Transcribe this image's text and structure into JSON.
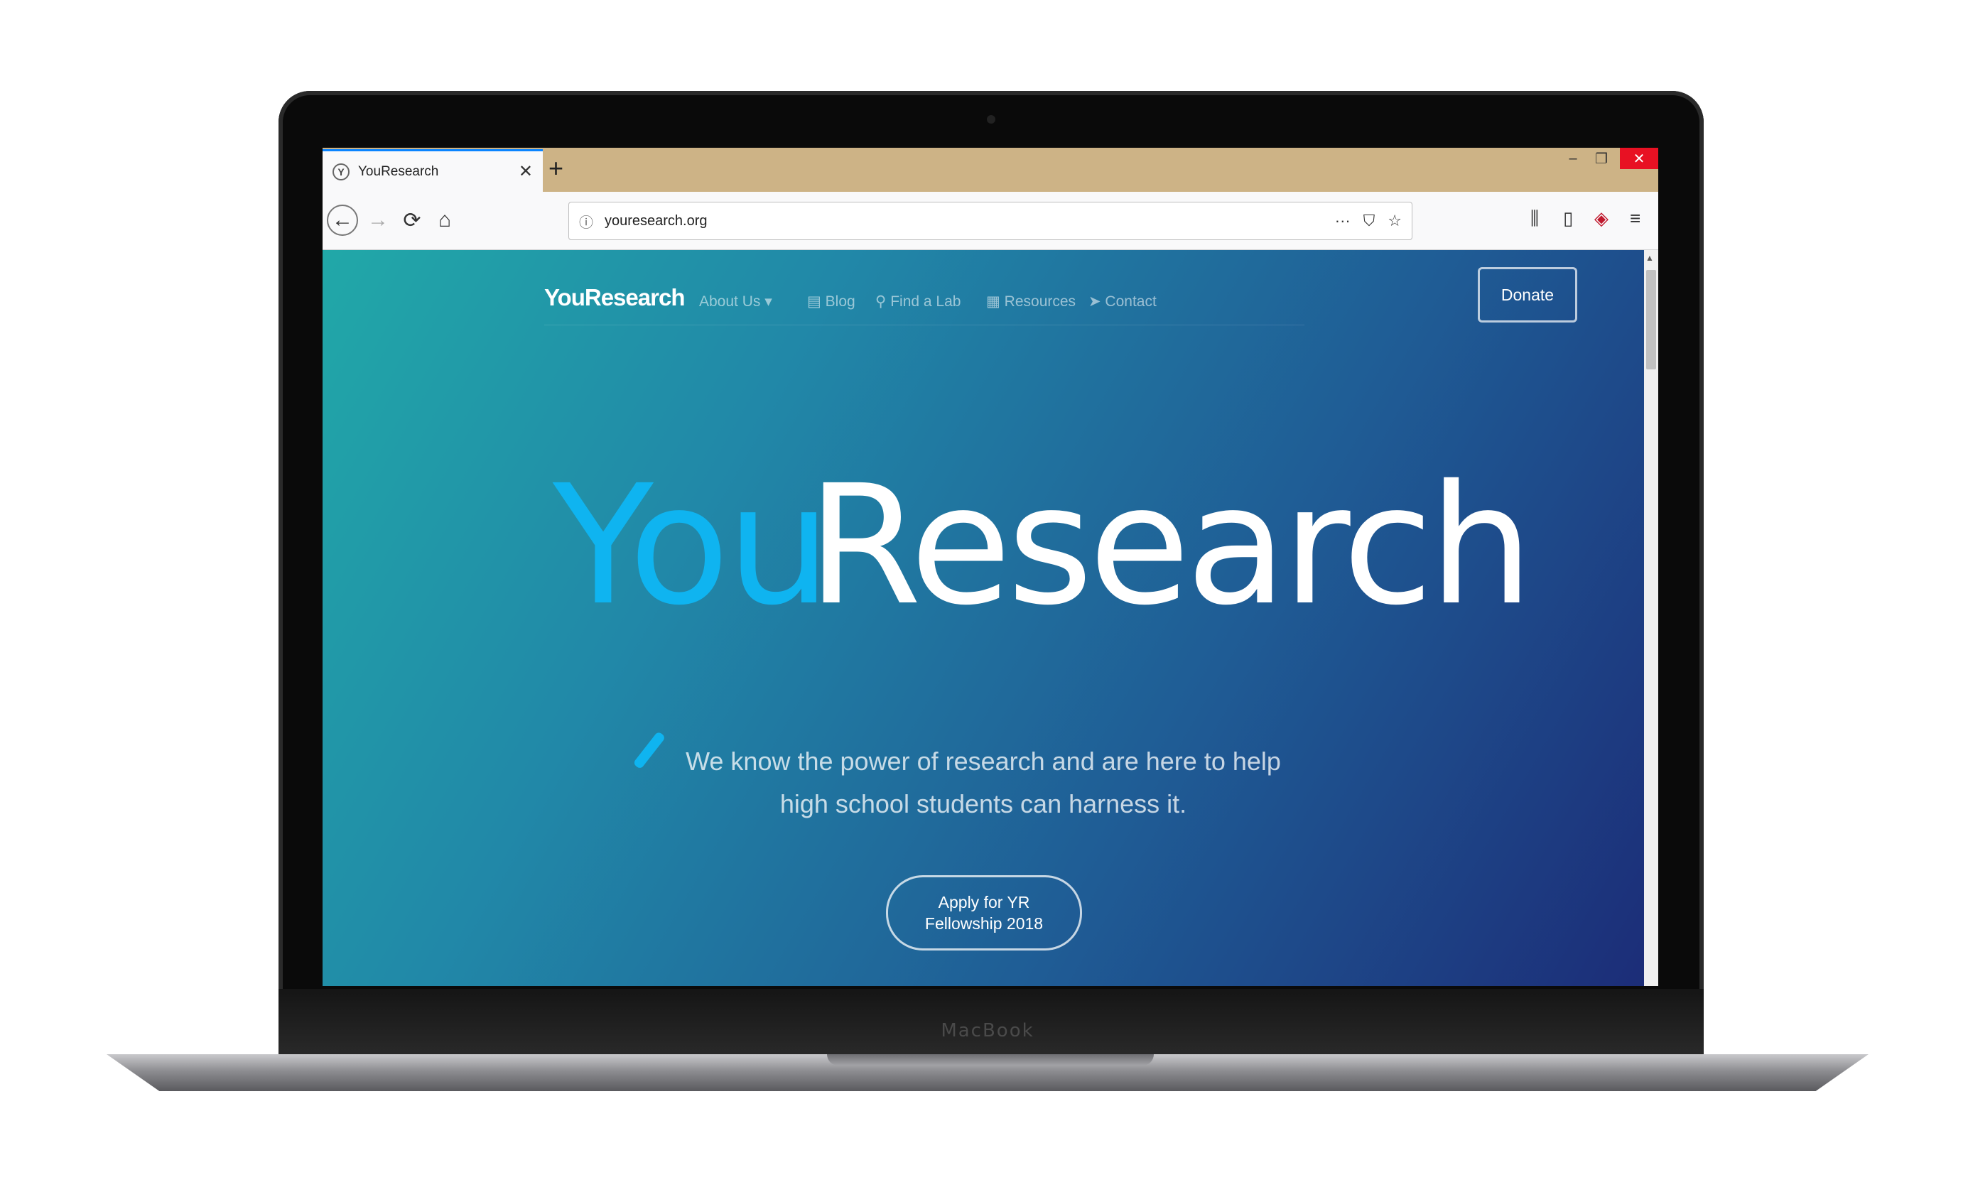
{
  "browser": {
    "tab_title": "YouResearch",
    "tab_favicon": "Y",
    "tab_close": "✕",
    "new_tab": "+",
    "window_controls": {
      "minimize": "–",
      "maximize": "❐",
      "close": "✕"
    },
    "nav": {
      "back": "←",
      "forward": "→",
      "reload": "⟳",
      "home": "⌂"
    },
    "url": "youresearch.org",
    "url_actions": {
      "more": "···",
      "pocket": "⛉",
      "bookmark": "☆"
    },
    "toolbar": {
      "library": "⫼",
      "sidebar": "▯",
      "extension": "◈",
      "menu": "≡"
    },
    "scroll_arrow": "▲"
  },
  "site": {
    "logo": "YouResearch",
    "nav_links": {
      "about": "About Us ▾",
      "blog": "▤ Blog",
      "find_lab": "⚲ Find a Lab",
      "resources": "▦ Resources",
      "contact": "➤ Contact"
    },
    "donate": "Donate",
    "hero_you": "You",
    "hero_research": "Research",
    "tagline": "We know the power of research and are here to help high school students can harness it.",
    "apply_button": "Apply for YR Fellowship 2018"
  },
  "device": {
    "brand": "MacBook"
  },
  "colors": {
    "accent_blue": "#0fb4f0",
    "tab_strip": "#cdb386",
    "gradient_start": "#21a8a8",
    "gradient_end": "#1c2d78"
  }
}
